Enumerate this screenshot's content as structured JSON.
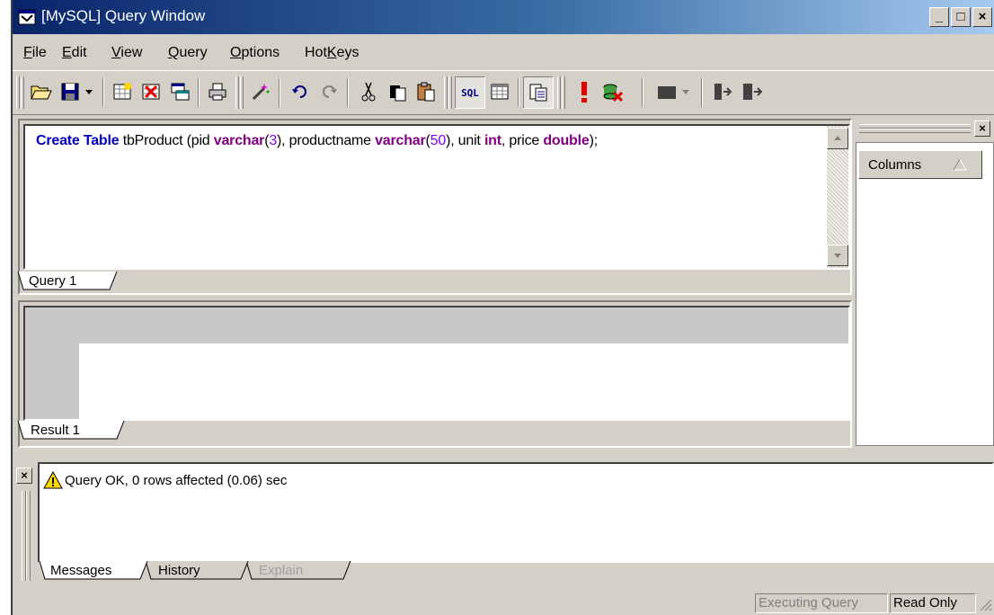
{
  "window": {
    "title": "[MySQL] Query Window"
  },
  "menu": [
    {
      "label": "File",
      "key": "F",
      "rest": "ile"
    },
    {
      "label": "Edit",
      "key": "E",
      "rest": "dit"
    },
    {
      "label": "View",
      "key": "V",
      "rest": "iew"
    },
    {
      "label": "Query",
      "key": "Q",
      "rest": "uery"
    },
    {
      "label": "Options",
      "key": "O",
      "rest": "ptions"
    },
    {
      "label": "HotKeys",
      "pre": "Hot",
      "key": "K",
      "rest": "eys"
    }
  ],
  "toolbar": {
    "icons": [
      "open-folder-icon",
      "save-icon",
      "save-dropdown-icon",
      "new-table-icon",
      "delete-table-icon",
      "window-icon",
      "print-icon",
      "magic-wand-icon",
      "undo-icon",
      "redo-icon",
      "cut-icon",
      "copy-icon",
      "paste-icon",
      "sql-mode-icon",
      "grid-mode-icon",
      "query-results-icon",
      "execute-icon",
      "cancel-execute-icon",
      "color-icon",
      "color-dropdown-icon",
      "insert-icon",
      "exit-icon"
    ],
    "sql_label": "SQL"
  },
  "editor": {
    "tokens": [
      {
        "t": "Create Table",
        "c": "kw-blue"
      },
      {
        "t": " tbProduct (pid ",
        "c": ""
      },
      {
        "t": "varchar",
        "c": "kw-purple"
      },
      {
        "t": "(",
        "c": ""
      },
      {
        "t": "3",
        "c": "num"
      },
      {
        "t": "), productname ",
        "c": ""
      },
      {
        "t": "varchar",
        "c": "kw-purple"
      },
      {
        "t": "(",
        "c": ""
      },
      {
        "t": "50",
        "c": "num"
      },
      {
        "t": "), unit ",
        "c": ""
      },
      {
        "t": "int",
        "c": "kw-purple"
      },
      {
        "t": ", price ",
        "c": ""
      },
      {
        "t": "double",
        "c": "kw-purple"
      },
      {
        "t": ");",
        "c": ""
      }
    ],
    "tab_label": "Query 1"
  },
  "result": {
    "tab_label": "Result 1"
  },
  "columns_panel": {
    "header": "Columns"
  },
  "messages": {
    "text": "Query OK, 0 rows affected (0.06) sec",
    "tabs": [
      "Messages",
      "History",
      "Explain"
    ]
  },
  "status": {
    "executing": "Executing Query",
    "readonly": "Read Only"
  },
  "colors": {
    "keyword_blue": "#0000c8",
    "keyword_purple": "#800080",
    "number": "#8000ff",
    "title_start": "#0a246a",
    "title_end": "#a6caf0"
  }
}
